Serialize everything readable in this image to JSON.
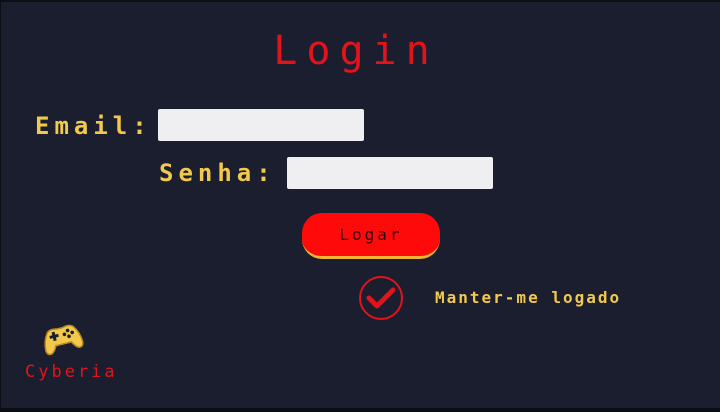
{
  "page": {
    "title": "Login"
  },
  "form": {
    "email_label": "Email:",
    "email_value": "",
    "senha_label": "Senha:",
    "senha_value": "",
    "submit_label": "Logar",
    "remember": {
      "label": "Manter-me logado",
      "checked": true
    }
  },
  "brand": {
    "name": "Cyberia",
    "icon": "gamepad-icon"
  },
  "colors": {
    "background": "#1b1e2e",
    "accent_red": "#e0141a",
    "accent_yellow": "#f2c94c",
    "button_red": "#ff0a0a"
  }
}
